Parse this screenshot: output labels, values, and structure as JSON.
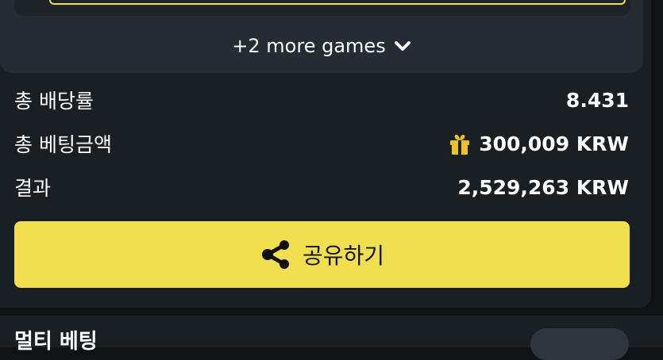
{
  "games_card": {
    "more_games_label": "+2 more games",
    "chevron_icon": "chevron-down-icon"
  },
  "summary": {
    "total_odds_label": "총 배당률",
    "total_odds_value": "8.431",
    "total_bet_label": "총 베팅금액",
    "total_bet_value": "300,009 KRW",
    "total_bet_icon": "gift-icon",
    "result_label": "결과",
    "result_value": "2,529,263 KRW"
  },
  "share_button": {
    "label": "공유하기",
    "icon": "share-icon"
  },
  "next_section": {
    "title": "멀티 베팅"
  },
  "colors": {
    "accent_yellow": "#f0df4f",
    "panel_bg": "#1a1f24",
    "card_bg": "#262c33",
    "page_bg": "#101316"
  }
}
